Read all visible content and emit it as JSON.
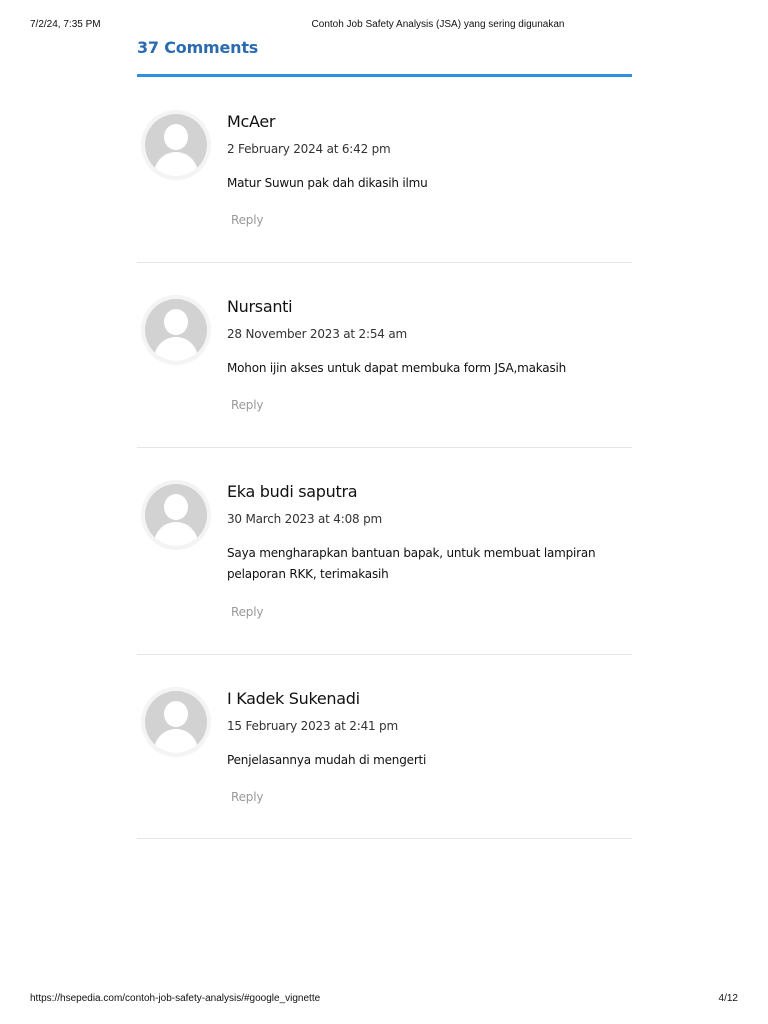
{
  "print_header": {
    "datetime": "7/2/24, 7:35 PM",
    "doc_title": "Contoh Job Safety Analysis (JSA) yang sering digunakan"
  },
  "print_footer": {
    "url": "https://hsepedia.com/contoh-job-safety-analysis/#google_vignette",
    "page": "4/12"
  },
  "comments_section": {
    "title": "37 Comments",
    "accent_color": "#3090e0",
    "title_color": "#2b6cb0",
    "reply_label": "Reply",
    "avatar_icon": "default-user-avatar-icon",
    "comments": [
      {
        "author": "McAer",
        "date": "2 February 2024 at 6:42 pm",
        "text": "Matur Suwun pak dah dikasih ilmu"
      },
      {
        "author": "Nursanti",
        "date": "28 November 2023 at 2:54 am",
        "text": "Mohon ijin akses untuk dapat membuka form JSA,makasih"
      },
      {
        "author": "Eka budi saputra",
        "date": "30 March 2023 at 4:08 pm",
        "text": "Saya mengharapkan bantuan bapak, untuk membuat lampiran pelaporan RKK, terimakasih"
      },
      {
        "author": "I Kadek Sukenadi",
        "date": "15 February 2023 at 2:41 pm",
        "text": "Penjelasannya mudah di mengerti"
      }
    ]
  }
}
